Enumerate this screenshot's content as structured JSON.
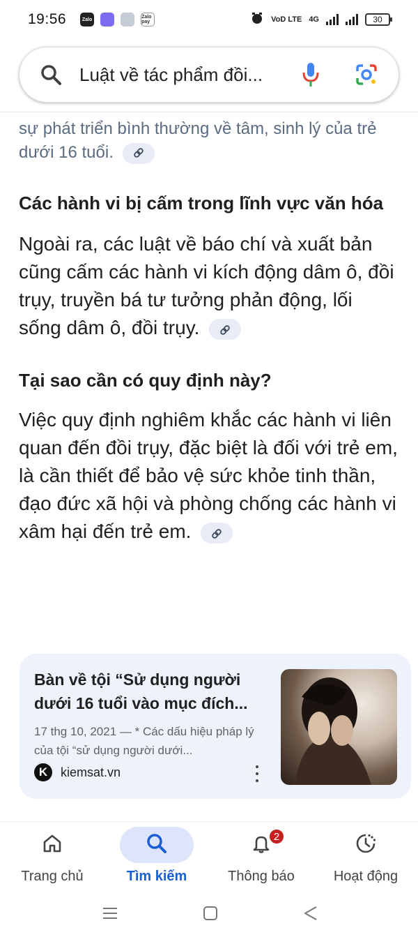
{
  "status_bar": {
    "time": "19:56",
    "apps": [
      "Zalo",
      "",
      "",
      "Zalo pay"
    ],
    "network_label": "VoD LTE",
    "network_type": "4G",
    "battery": "30"
  },
  "search": {
    "query": "Luật về tác phẩm đồi...",
    "icons": [
      "search-icon",
      "mic-icon",
      "lens-icon"
    ]
  },
  "content": {
    "faded_text": "sự phát triển bình thường về tâm, sinh lý của trẻ dưới 16 tuổi.",
    "section1_heading": "Các hành vi bị cấm trong lĩnh vực văn hóa",
    "section1_text": "Ngoài ra, các luật về báo chí và xuất bản cũng cấm các hành vi kích động dâm ô, đồi trụy, truyền bá tư tưởng phản động, lối sống dâm ô, đồi trụy.",
    "section2_heading": "Tại sao cần có quy định này?",
    "section2_text": "Việc quy định nghiêm khắc các hành vi liên quan đến đồi trụy, đặc biệt là đối với trẻ em, là cần thiết để bảo vệ sức khỏe tinh thần, đạo đức xã hội và phòng chống các hành vi xâm hại đến trẻ em."
  },
  "result_card": {
    "title": "Bàn về tội “Sử dụng người dưới 16 tuổi vào mục đích...",
    "snippet": "17 thg 10, 2021 — * Các dấu hiệu pháp lý của tội “sử dụng người dưới...",
    "source": "kiemsat.vn",
    "favicon_letter": "K"
  },
  "bottom_nav": {
    "items": [
      {
        "label": "Trang chủ",
        "icon": "home-icon"
      },
      {
        "label": "Tìm kiếm",
        "icon": "search-icon",
        "active": true
      },
      {
        "label": "Thông báo",
        "icon": "bell-icon",
        "badge": "2"
      },
      {
        "label": "Hoạt động",
        "icon": "activity-icon"
      }
    ]
  },
  "colors": {
    "accent": "#1a5ed4",
    "active_pill": "#dce5fb",
    "card_bg": "#eef2fc",
    "badge": "#c5221f"
  }
}
